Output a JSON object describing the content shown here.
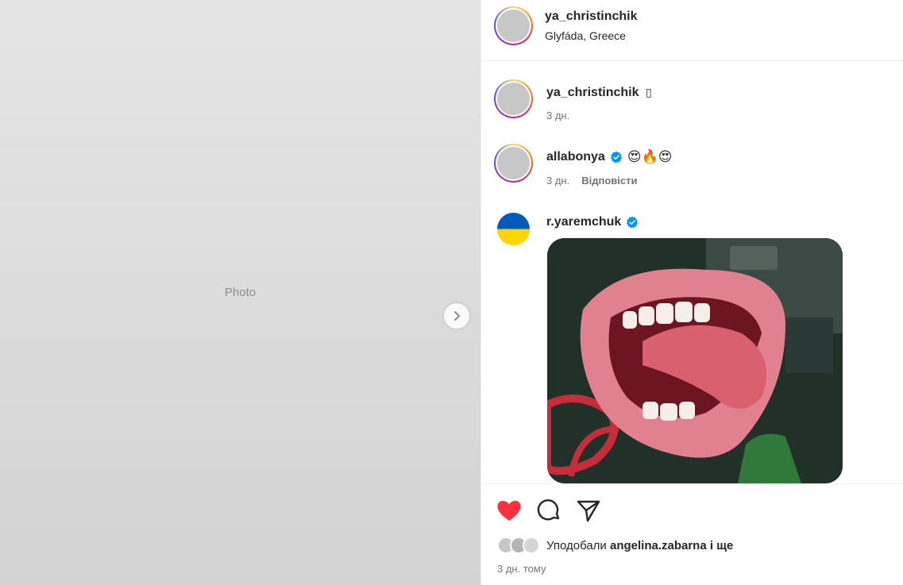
{
  "media": {
    "alt_label": "Photo",
    "next_button_icon": "chevron-right-icon"
  },
  "header": {
    "username": "ya_christinchik",
    "location": "Glyfáda, Greece"
  },
  "comments": [
    {
      "username": "ya_christinchik",
      "text": "▯",
      "time": "3 дн."
    },
    {
      "username": "allabonya",
      "verified": true,
      "text": "😍🔥😍",
      "time": "3 дн.",
      "reply_label": "Відповісти"
    },
    {
      "username": "r.yaremchuk",
      "verified": true,
      "attachment": "gif"
    }
  ],
  "actions": {
    "like_icon": "heart-filled-icon",
    "comment_icon": "comment-icon",
    "share_icon": "send-icon"
  },
  "likes": {
    "prefix": "Уподобали",
    "user": "angelina.zabarna",
    "suffix": "і ще"
  },
  "post_time": "3 дн. тому",
  "colors": {
    "like_red": "#ff3040",
    "verified_blue": "#0095f6",
    "ukraine_blue": "#005bbb",
    "ukraine_yellow": "#ffd500"
  }
}
